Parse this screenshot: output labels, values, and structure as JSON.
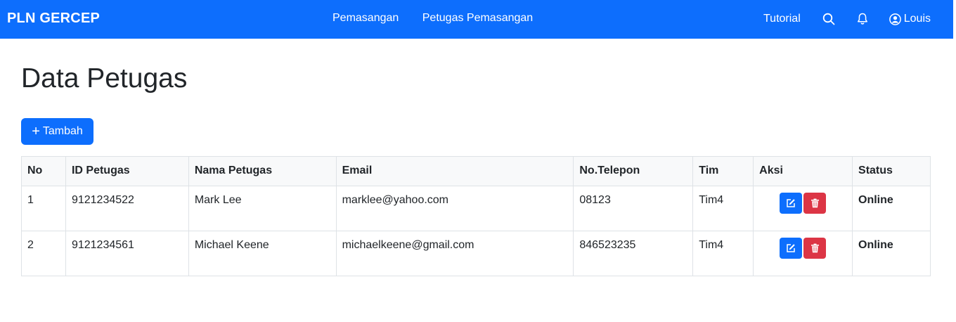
{
  "navbar": {
    "brand": "PLN GERCEP",
    "links": [
      "Pemasangan",
      "Petugas Pemasangan"
    ],
    "tutorial": "Tutorial",
    "user": "Louis"
  },
  "page": {
    "title": "Data Petugas",
    "add_button": "Tambah"
  },
  "table": {
    "headers": [
      "No",
      "ID Petugas",
      "Nama Petugas",
      "Email",
      "No.Telepon",
      "Tim",
      "Aksi",
      "Status"
    ],
    "rows": [
      {
        "no": "1",
        "id": "9121234522",
        "nama": "Mark Lee",
        "email": "marklee@yahoo.com",
        "telepon": "08123",
        "tim": "Tim4",
        "status": "Online"
      },
      {
        "no": "2",
        "id": "9121234561",
        "nama": "Michael Keene",
        "email": "michaelkeene@gmail.com",
        "telepon": "846523235",
        "tim": "Tim4",
        "status": "Online"
      }
    ]
  },
  "colors": {
    "primary": "#0d6efd",
    "danger": "#dc3545",
    "success": "#198754"
  }
}
